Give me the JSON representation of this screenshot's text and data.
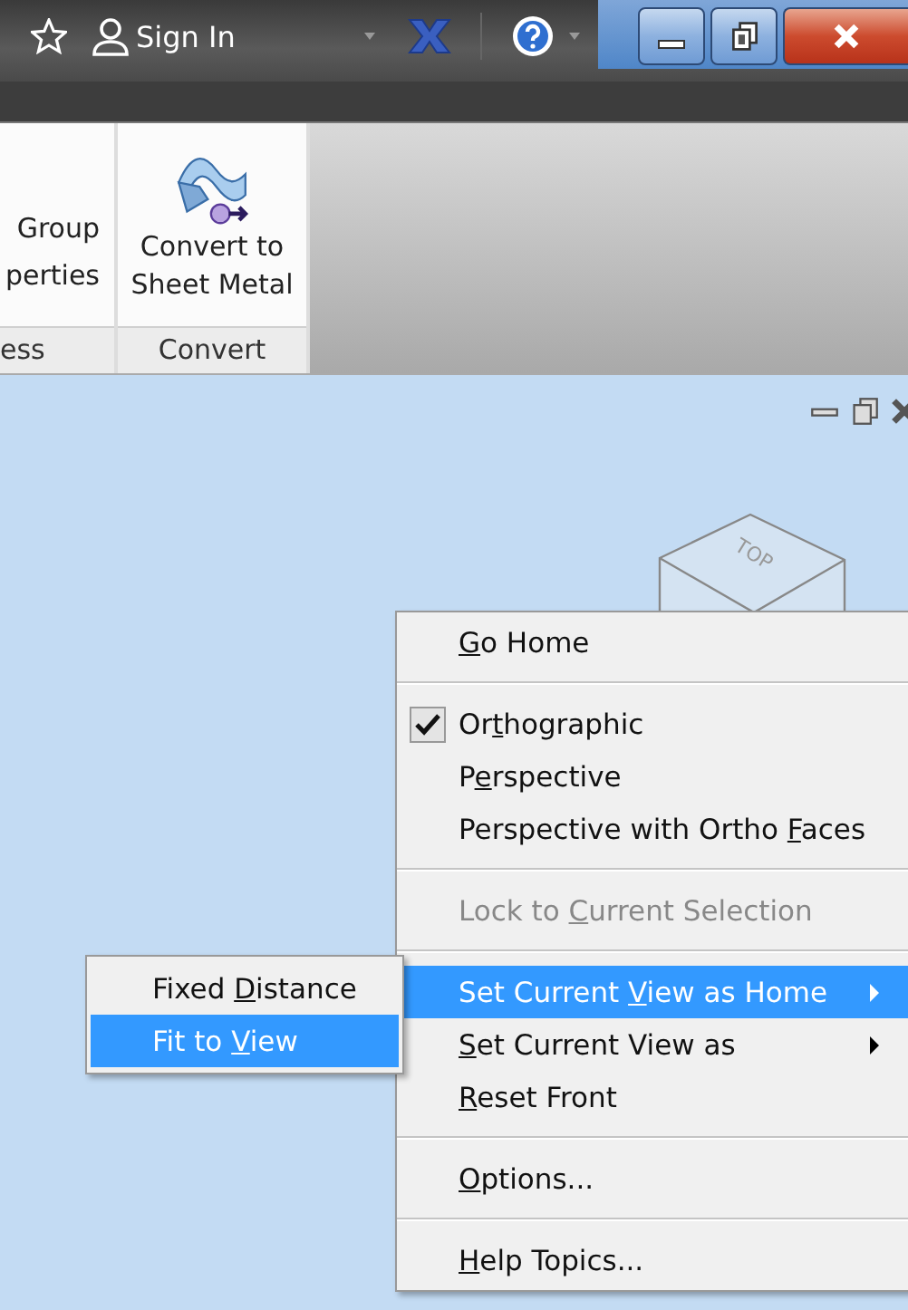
{
  "title_bar": {
    "sign_in": "Sign In"
  },
  "ribbon": {
    "panels": [
      {
        "kind": "small",
        "buttons": [
          "Group",
          "perties"
        ],
        "label": "ess"
      },
      {
        "kind": "large",
        "buttons": [
          "Convert to\nSheet Metal"
        ],
        "label": "Convert"
      }
    ]
  },
  "view_cube": {
    "label": "TOP"
  },
  "context_menu": {
    "items": [
      {
        "kind": "item",
        "after": "o Home",
        "key": "G",
        "checked": false,
        "disabled": false,
        "selected": false,
        "submenu": false
      },
      {
        "kind": "separator"
      },
      {
        "kind": "item",
        "before": "Or",
        "key": "t",
        "after": "hographic",
        "checked": true,
        "disabled": false,
        "selected": false,
        "submenu": false
      },
      {
        "kind": "item",
        "before": "P",
        "key": "e",
        "after": "rspective",
        "checked": false,
        "disabled": false,
        "selected": false,
        "submenu": false
      },
      {
        "kind": "item",
        "before": "Perspective with Ortho ",
        "key": "F",
        "after": "aces",
        "checked": false,
        "disabled": false,
        "selected": false,
        "submenu": false
      },
      {
        "kind": "separator"
      },
      {
        "kind": "item",
        "before": "Lock to ",
        "key": "C",
        "after": "urrent Selection",
        "checked": false,
        "disabled": true,
        "selected": false,
        "submenu": false
      },
      {
        "kind": "separator"
      },
      {
        "kind": "item",
        "before": "Set Current ",
        "key": "V",
        "after": "iew as Home",
        "checked": false,
        "disabled": false,
        "selected": true,
        "submenu": true
      },
      {
        "kind": "item",
        "key": "S",
        "after": "et Current View as",
        "checked": false,
        "disabled": false,
        "selected": false,
        "submenu": true
      },
      {
        "kind": "item",
        "key": "R",
        "after": "eset Front",
        "checked": false,
        "disabled": false,
        "selected": false,
        "submenu": false
      },
      {
        "kind": "separator"
      },
      {
        "kind": "item",
        "key": "O",
        "after": "ptions...",
        "checked": false,
        "disabled": false,
        "selected": false,
        "submenu": false
      },
      {
        "kind": "separator"
      },
      {
        "kind": "item",
        "key": "H",
        "after": "elp Topics...",
        "checked": false,
        "disabled": false,
        "selected": false,
        "submenu": false
      }
    ]
  },
  "submenu": {
    "items": [
      {
        "before": "Fixed ",
        "key": "D",
        "after": "istance",
        "selected": false
      },
      {
        "before": "Fit to ",
        "key": "V",
        "after": "iew",
        "selected": true
      }
    ]
  }
}
